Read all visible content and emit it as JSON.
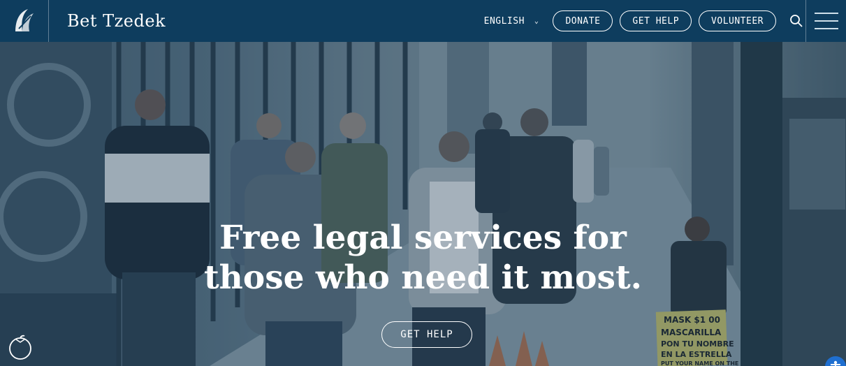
{
  "brand": {
    "logo_icon": "bet-tzedek-leaf-logo",
    "name": "Bet Tzedek"
  },
  "nav": {
    "language": "ENGLISH",
    "language_icon": "chevron-down-icon",
    "donate": "DONATE",
    "get_help": "GET HELP",
    "volunteer": "VOLUNTEER",
    "search_icon": "search-icon",
    "menu_icon": "hamburger-menu-icon"
  },
  "hero": {
    "headline_line1": "Free legal services for",
    "headline_line2": "those who need it most.",
    "cta": "GET HELP",
    "sign_text": "MASK $1 00 MASCARILLA PON TU NOMBRE EN LA ESTRELLA PUT YOUR NAME ON THE"
  },
  "widgets": {
    "corner_icon": "apple-outline-icon",
    "accessibility_icon": "accessibility-icon"
  },
  "colors": {
    "header_bg": "#0e3d5e",
    "accessibility_blue": "#1f6fd0",
    "text": "#ffffff"
  }
}
